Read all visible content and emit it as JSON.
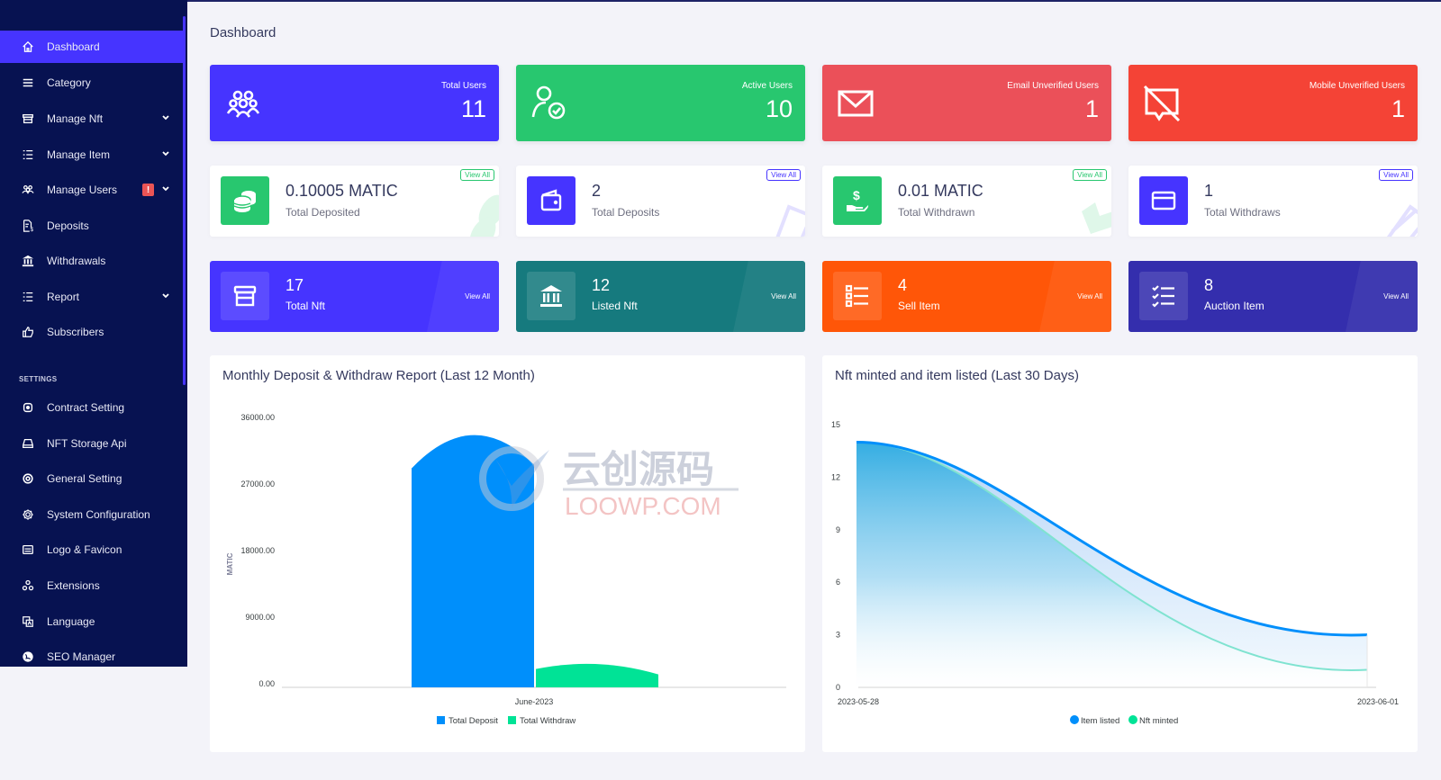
{
  "page": {
    "title": "Dashboard"
  },
  "sidebar": {
    "items": [
      {
        "label": "Dashboard",
        "icon": "home-icon",
        "active": true
      },
      {
        "label": "Category",
        "icon": "menu-icon"
      },
      {
        "label": "Manage Nft",
        "icon": "store-icon",
        "dropdown": true
      },
      {
        "label": "Manage Item",
        "icon": "list-icon",
        "dropdown": true
      },
      {
        "label": "Manage Users",
        "icon": "users-icon",
        "dropdown": true,
        "badge": "!"
      },
      {
        "label": "Deposits",
        "icon": "file-invoice-dollar-icon"
      },
      {
        "label": "Withdrawals",
        "icon": "bank-icon"
      },
      {
        "label": "Report",
        "icon": "list-icon",
        "dropdown": true
      },
      {
        "label": "Subscribers",
        "icon": "thumbs-up-icon"
      }
    ],
    "section_label": "SETTINGS",
    "settings_items": [
      {
        "label": "Contract Setting",
        "icon": "contract-icon"
      },
      {
        "label": "NFT Storage Api",
        "icon": "hdd-icon"
      },
      {
        "label": "General Setting",
        "icon": "life-ring-icon"
      },
      {
        "label": "System Configuration",
        "icon": "gear-icon"
      },
      {
        "label": "Logo & Favicon",
        "icon": "image-icon"
      },
      {
        "label": "Extensions",
        "icon": "cubes-icon"
      },
      {
        "label": "Language",
        "icon": "language-icon"
      },
      {
        "label": "SEO Manager",
        "icon": "globe-icon"
      }
    ]
  },
  "stats_row1": [
    {
      "label": "Total Users",
      "value": "11",
      "color": "#4634ff",
      "icon": "users-icon"
    },
    {
      "label": "Active Users",
      "value": "10",
      "color": "#28c76f",
      "icon": "user-check-icon"
    },
    {
      "label": "Email Unverified Users",
      "value": "1",
      "color": "#eb5059",
      "icon": "envelope-icon"
    },
    {
      "label": "Mobile Unverified Users",
      "value": "1",
      "color": "#f44336",
      "icon": "comment-slash-icon"
    }
  ],
  "stats_row2": [
    {
      "value": "0.10005 MATIC",
      "label": "Total Deposited",
      "view_all": "View All",
      "color": "#28c76f",
      "icon": "coins-icon"
    },
    {
      "value": "2",
      "label": "Total Deposits",
      "view_all": "View All",
      "color": "#4634ff",
      "icon": "wallet-icon"
    },
    {
      "value": "0.01 MATIC",
      "label": "Total Withdrawn",
      "view_all": "View All",
      "color": "#28c76f",
      "icon": "hand-dollar-icon"
    },
    {
      "value": "1",
      "label": "Total Withdraws",
      "view_all": "View All",
      "color": "#4634ff",
      "icon": "credit-card-icon"
    }
  ],
  "stats_row3": [
    {
      "value": "17",
      "label": "Total Nft",
      "view_all": "View All",
      "color": "#4634ff",
      "icon": "store-icon"
    },
    {
      "value": "12",
      "label": "Listed Nft",
      "view_all": "View All",
      "color": "#167a7e",
      "icon": "bank-icon"
    },
    {
      "value": "4",
      "label": "Sell Item",
      "view_all": "View All",
      "color": "#ff5608",
      "icon": "list-icon"
    },
    {
      "value": "8",
      "label": "Auction Item",
      "view_all": "View All",
      "color": "#342ead",
      "icon": "checklist-icon"
    }
  ],
  "chart_data": [
    {
      "type": "bar",
      "title": "Monthly Deposit & Withdraw Report (Last 12 Month)",
      "categories": [
        "June-2023"
      ],
      "series": [
        {
          "name": "Total Deposit",
          "values": [
            34000
          ],
          "color": "#008ffb"
        },
        {
          "name": "Total Withdraw",
          "values": [
            3400
          ],
          "color": "#00e396"
        }
      ],
      "xlabel": "",
      "ylabel": "MATIC",
      "ylim": [
        0,
        36000
      ],
      "yticks": [
        "0.00",
        "9000.00",
        "18000.00",
        "27000.00",
        "36000.00"
      ],
      "legend": "bottom"
    },
    {
      "type": "area",
      "title": "Nft minted and item listed (Last 30 Days)",
      "x": [
        "2023-05-28",
        "2023-06-01"
      ],
      "series": [
        {
          "name": "Item listed",
          "values": [
            14,
            3
          ],
          "color": "#008ffb"
        },
        {
          "name": "Nft minted",
          "values": [
            14,
            1
          ],
          "color": "#00e396"
        }
      ],
      "ylim": [
        0,
        15
      ],
      "yticks": [
        "0",
        "3",
        "6",
        "9",
        "12",
        "15"
      ],
      "legend": "bottom"
    }
  ],
  "watermark": {
    "line1": "云创源码",
    "line2": "LOOWP.COM"
  }
}
